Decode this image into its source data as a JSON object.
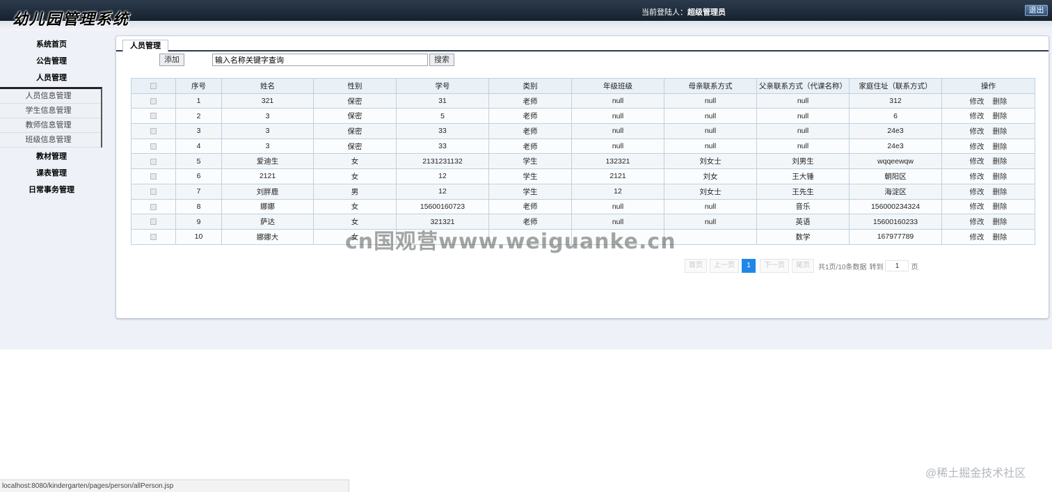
{
  "header": {
    "logo": "幼儿园管理系统",
    "login_label": "当前登陆人：",
    "login_user": "超级管理员",
    "logout_label": "退出"
  },
  "sidebar": {
    "items": [
      {
        "label": "系统首页"
      },
      {
        "label": "公告管理"
      },
      {
        "label": "人员管理"
      }
    ],
    "submenu": [
      {
        "label": "人员信息管理"
      },
      {
        "label": "学生信息管理"
      },
      {
        "label": "教师信息管理"
      },
      {
        "label": "班级信息管理"
      }
    ],
    "items_after": [
      {
        "label": "教材管理"
      },
      {
        "label": "课表管理"
      },
      {
        "label": "日常事务管理"
      }
    ]
  },
  "main": {
    "tab_label": "人员管理",
    "add_label": "添加",
    "search_value": "输入名称关键字查询",
    "search_label": "搜索"
  },
  "table": {
    "headers": [
      "序号",
      "姓名",
      "性别",
      "学号",
      "类别",
      "年级班级",
      "母亲联系方式",
      "父亲联系方式（代课名称）",
      "家庭住址（联系方式）",
      "操作"
    ],
    "edit_label": "修改",
    "delete_label": "删除",
    "rows": [
      [
        "1",
        "321",
        "保密",
        "31",
        "老师",
        "null",
        "null",
        "null",
        "312"
      ],
      [
        "2",
        "3",
        "保密",
        "5",
        "老师",
        "null",
        "null",
        "null",
        "6"
      ],
      [
        "3",
        "3",
        "保密",
        "33",
        "老师",
        "null",
        "null",
        "null",
        "24e3"
      ],
      [
        "4",
        "3",
        "保密",
        "33",
        "老师",
        "null",
        "null",
        "null",
        "24e3"
      ],
      [
        "5",
        "爱迪生",
        "女",
        "2131231132",
        "学生",
        "132321",
        "刘女士",
        "刘男生",
        "wqqeewqw"
      ],
      [
        "6",
        "2121",
        "女",
        "12",
        "学生",
        "2121",
        "刘女",
        "王大锤",
        "朝阳区"
      ],
      [
        "7",
        "刘胖鹿",
        "男",
        "12",
        "学生",
        "12",
        "刘女士",
        "王先生",
        "海淀区"
      ],
      [
        "8",
        "娜娜",
        "女",
        "15600160723",
        "老师",
        "null",
        "null",
        "音乐",
        "156000234324"
      ],
      [
        "9",
        "萨达",
        "女",
        "321321",
        "老师",
        "null",
        "null",
        "英语",
        "15600160233"
      ],
      [
        "10",
        "娜娜大",
        "女",
        "",
        "",
        "",
        "",
        "数学",
        "167977789"
      ]
    ]
  },
  "pagination": {
    "first": "首页",
    "prev": "上一页",
    "current": "1",
    "next": "下一页",
    "last": "尾页",
    "info": "共1页/10条数据",
    "goto_label": "转到",
    "goto_value": "1",
    "page_suffix": "页"
  },
  "watermark": {
    "center": "cn国观营www.weiguanke.cn",
    "corner": "@稀土掘金技术社区"
  },
  "status_url": "localhost:8080/kindergarten/pages/person/allPerson.jsp"
}
